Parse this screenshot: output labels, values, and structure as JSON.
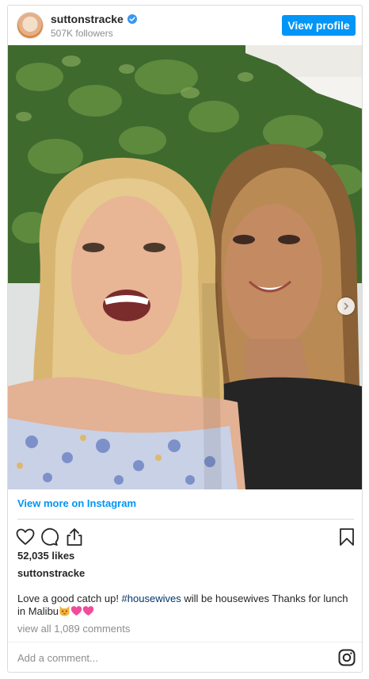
{
  "header": {
    "username": "suttonstracke",
    "followers": "507K followers",
    "view_profile": "View profile"
  },
  "photo": {
    "icon": "carousel-next-icon"
  },
  "view_more": "View more on Instagram",
  "likes": "52,035 likes",
  "owner": "suttonstracke",
  "caption": {
    "text_before": "Love a good catch up! ",
    "hashtag": "#housewives",
    "text_after": " will be housewives Thanks for lunch in Malibu",
    "emoji": [
      "cat-face-emoji",
      "pink-heart-emoji",
      "pink-heart-emoji"
    ]
  },
  "comments": "view all 1,089 comments",
  "add_comment_placeholder": "Add a comment...",
  "colors": {
    "accent": "#0095f6",
    "hashtag": "#00376b",
    "muted": "#8e8e8e",
    "border": "#dbdbdb"
  }
}
